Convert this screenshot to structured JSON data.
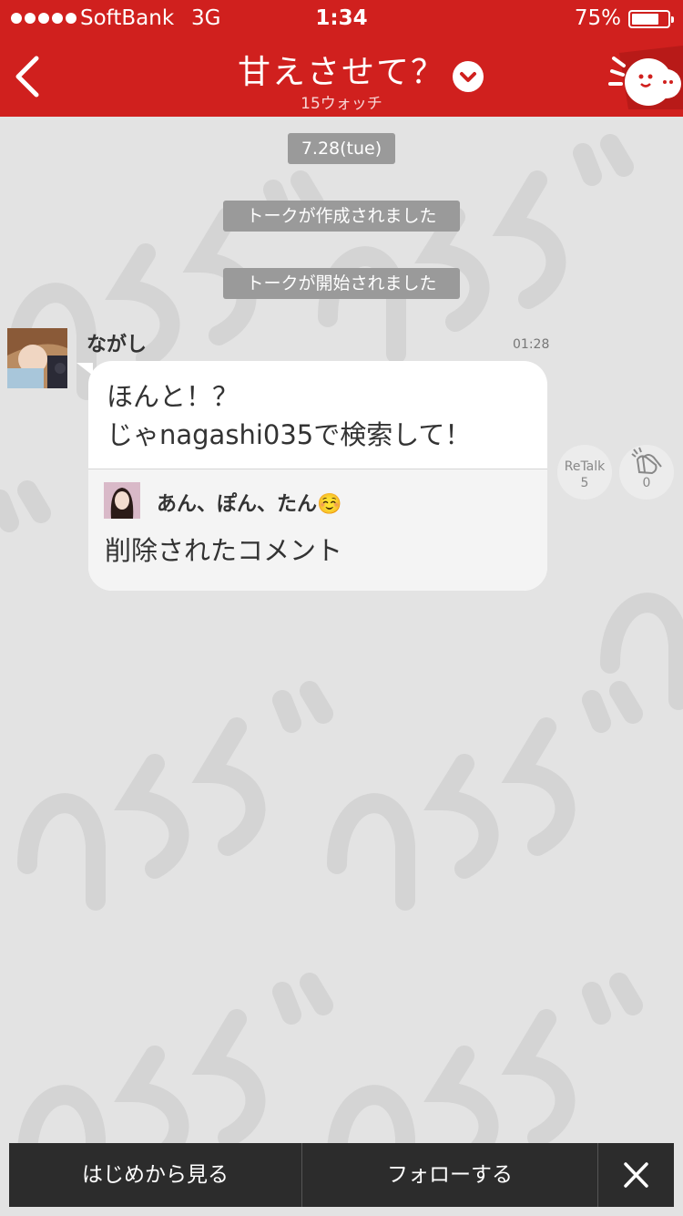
{
  "status_bar": {
    "carrier": "SoftBank",
    "network": "3G",
    "time": "1:34",
    "battery_percent": "75%",
    "battery_level": 0.75
  },
  "header": {
    "title": "甘えさせて？",
    "subtitle": "15ウォッチ"
  },
  "chat": {
    "date_label": "7.28(tue)",
    "system_messages": [
      "トークが作成されました",
      "トークが開始されました"
    ],
    "message": {
      "sender": "ながし",
      "time": "01:28",
      "lines": [
        "ほんと！？",
        "じゃnagashi035で検索して！"
      ],
      "quote": {
        "user": "あん、ぽん、たん☺️",
        "text": "削除されたコメント"
      },
      "retalk_label": "ReTalk",
      "retalk_count": "5",
      "clap_count": "0"
    }
  },
  "bottom_bar": {
    "start_label": "はじめから見る",
    "follow_label": "フォローする"
  },
  "colors": {
    "header_red": "#d0201e",
    "background": "#e3e3e3",
    "watermark": "#d3d3d3",
    "bottom_bar": "#2c2c2c"
  }
}
